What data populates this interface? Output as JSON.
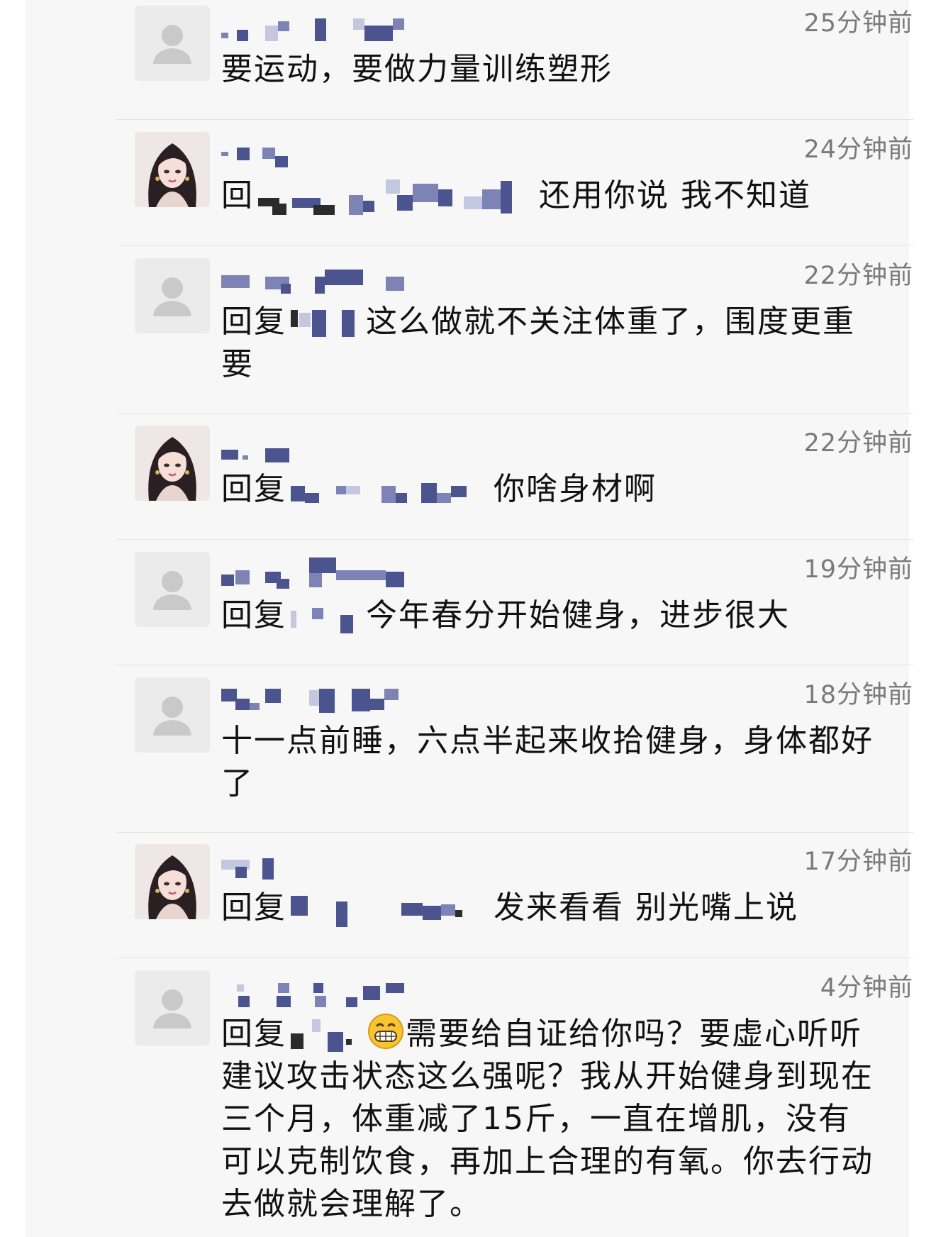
{
  "comments": [
    {
      "avatar_icon": "default-user-avatar-icon",
      "time": "25分钟前",
      "text": "要运动，要做力量训练塑形"
    },
    {
      "avatar_icon": "illustrated-girl-avatar-icon",
      "time": "24分钟前",
      "reply_prefix": "回",
      "text": "还用你说 我不知道"
    },
    {
      "avatar_icon": "default-user-avatar-icon",
      "time": "22分钟前",
      "reply_prefix": "回复",
      "text_line1": "这么做就不关注体重了，围度更重",
      "text_line2": "要"
    },
    {
      "avatar_icon": "illustrated-girl-avatar-icon",
      "time": "22分钟前",
      "reply_prefix": "回复",
      "text": "你啥身材啊"
    },
    {
      "avatar_icon": "default-user-avatar-icon",
      "time": "19分钟前",
      "reply_prefix": "回复",
      "text": "今年春分开始健身，进步很大"
    },
    {
      "avatar_icon": "default-user-avatar-icon",
      "time": "18分钟前",
      "text_line1": "十一点前睡，六点半起来收拾健身，身体都好",
      "text_line2": "了"
    },
    {
      "avatar_icon": "illustrated-girl-avatar-icon",
      "time": "17分钟前",
      "reply_prefix": "回复",
      "text": "发来看看 别光嘴上说"
    },
    {
      "avatar_icon": "default-user-avatar-icon",
      "time": "4分钟前",
      "reply_prefix": "回复",
      "emoji": "grinning-face-emoji",
      "text_line1": "需要给自证给你吗？要虚心听听",
      "text_line2": "建议攻击状态这么强呢？我从开始健身到现在",
      "text_line3": "三个月，体重减了15斤，一直在增肌，没有",
      "text_line4": "可以克制饮食，再加上合理的有氧。你去行动",
      "text_line5": "去做就会理解了。"
    }
  ]
}
